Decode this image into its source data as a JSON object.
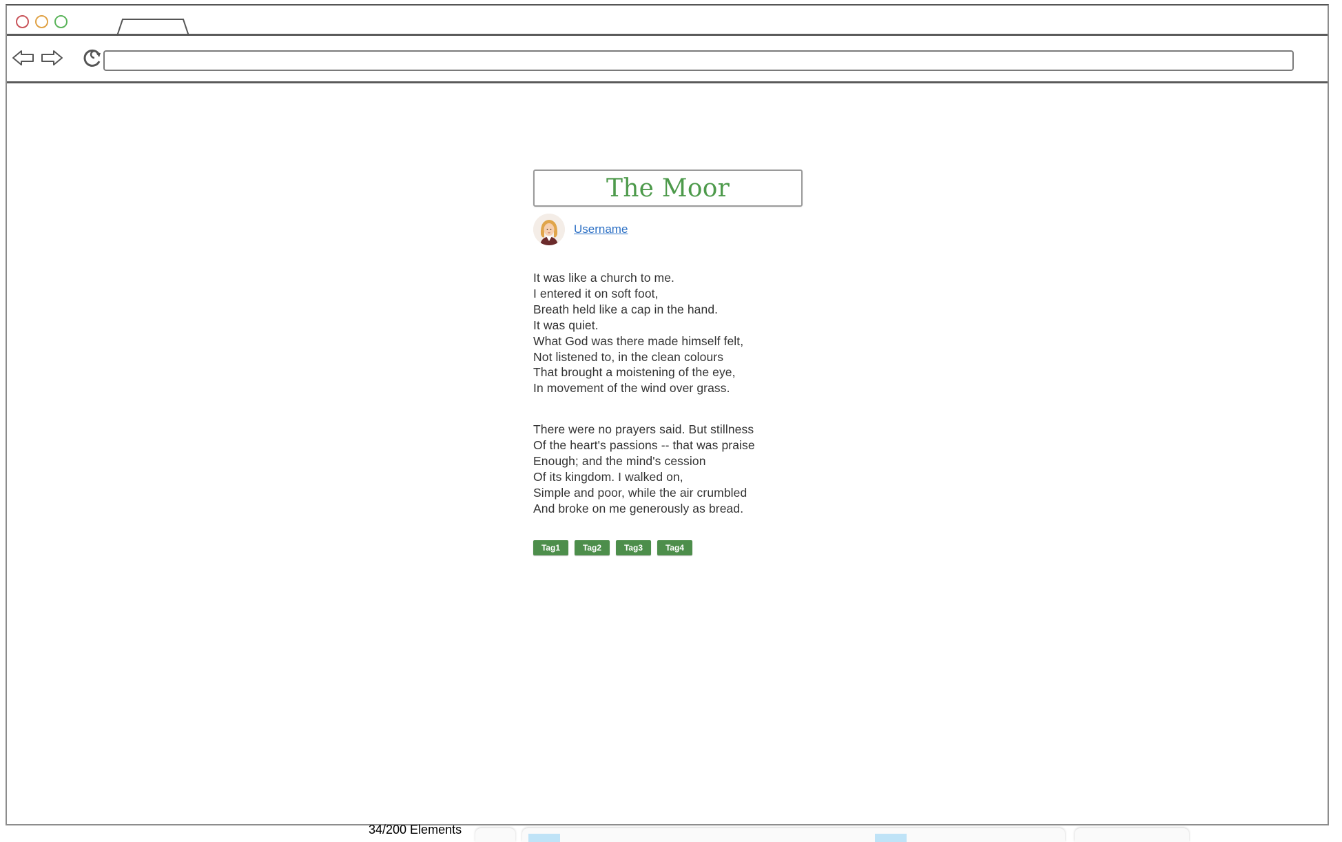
{
  "browser": {
    "icons": {
      "back": "back-arrow-icon",
      "forward": "forward-arrow-icon",
      "reload": "reload-icon"
    },
    "address_value": ""
  },
  "post": {
    "title": "The Moor",
    "author": {
      "username": "Username"
    },
    "stanzas": [
      [
        "It was like a church to me.",
        "I entered it on soft foot,",
        "Breath held like a cap in the hand.",
        "It was quiet.",
        "What God was there made himself felt,",
        "Not listened to, in the clean colours",
        "That brought a moistening of the eye,",
        "In movement of the wind over grass."
      ],
      [
        "There were no prayers said. But stillness",
        "Of the heart's passions -- that was praise",
        "Enough; and the mind's cession",
        "Of its kingdom. I walked on,",
        "Simple and poor, while the air crumbled",
        "And broke on me generously as bread."
      ]
    ],
    "tags": [
      "Tag1",
      "Tag2",
      "Tag3",
      "Tag4"
    ]
  },
  "footer": {
    "element_count": "34/200 Elements"
  },
  "colors": {
    "title_green": "#4d9a4b",
    "tag_green": "#4d8e4b",
    "link_blue": "#2b6fc4"
  }
}
